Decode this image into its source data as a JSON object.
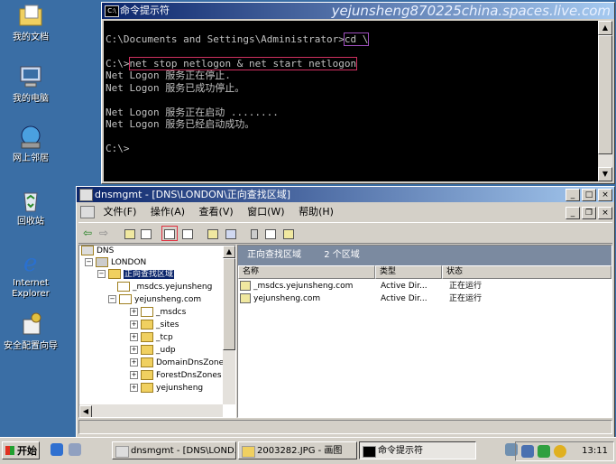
{
  "desktop": {
    "icons": [
      {
        "label": "我的文档"
      },
      {
        "label": "我的电脑"
      },
      {
        "label": "网上邻居"
      },
      {
        "label": "回收站"
      },
      {
        "label": "Internet Explorer"
      },
      {
        "label": "安全配置向导"
      }
    ]
  },
  "console": {
    "title": "命令提示符",
    "watermark": "yejunsheng870225china.spaces.live.com",
    "lines": {
      "l1_prompt": "C:\\Documents and Settings\\Administrator>",
      "l1_cmd": "cd \\",
      "l2_prompt": "C:\\>",
      "l2_cmd": "net stop netlogon & net start netlogon",
      "l3": "Net Logon 服务正在停止.",
      "l4": "Net Logon 服务已成功停止。",
      "l5": "Net Logon 服务正在启动 ........",
      "l6": "Net Logon 服务已经启动成功。",
      "l7": "C:\\>"
    }
  },
  "mmc": {
    "title": "dnsmgmt - [DNS\\LONDON\\正向查找区域]",
    "menu": [
      "文件(F)",
      "操作(A)",
      "查看(V)",
      "窗口(W)",
      "帮助(H)"
    ],
    "tree": {
      "root": "DNS",
      "server": "LONDON",
      "zone_folder": "正向查找区域",
      "zone1": "_msdcs.yejunsheng",
      "zone2": "yejunsheng.com",
      "children": [
        "_msdcs",
        "_sites",
        "_tcp",
        "_udp",
        "DomainDnsZones",
        "ForestDnsZones",
        "yejunsheng"
      ]
    },
    "right": {
      "header_title": "正向查找区域",
      "header_count": "2 个区域",
      "columns": [
        "名称",
        "类型",
        "状态"
      ],
      "rows": [
        {
          "name": "_msdcs.yejunsheng.com",
          "type": "Active Dir...",
          "status": "正在运行"
        },
        {
          "name": "yejunsheng.com",
          "type": "Active Dir...",
          "status": "正在运行"
        }
      ]
    }
  },
  "taskbar": {
    "start": "开始",
    "buttons": [
      {
        "label": "dnsmgmt - [DNS\\LOND..."
      },
      {
        "label": "2003282.JPG - 画图"
      },
      {
        "label": "命令提示符"
      }
    ],
    "clock": "13:11"
  }
}
